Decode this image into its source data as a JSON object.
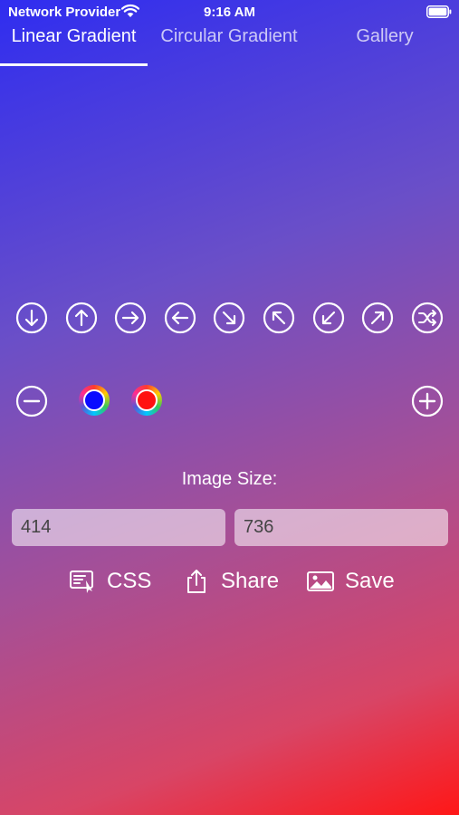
{
  "status_bar": {
    "carrier": "Network Provider",
    "time": "9:16 AM"
  },
  "tabs": [
    {
      "label": "Linear Gradient",
      "selected": true
    },
    {
      "label": "Circular Gradient",
      "selected": false
    },
    {
      "label": "Gallery",
      "selected": false
    }
  ],
  "direction_buttons": [
    "arrow-down-icon",
    "arrow-up-icon",
    "arrow-right-icon",
    "arrow-left-icon",
    "arrow-down-right-icon",
    "arrow-up-left-icon",
    "arrow-down-left-icon",
    "arrow-up-right-icon",
    "shuffle-icon"
  ],
  "colors": [
    {
      "name": "color-1",
      "value": "#0a0aff"
    },
    {
      "name": "color-2",
      "value": "#ff1111"
    }
  ],
  "image_size": {
    "label": "Image Size:",
    "width": "414",
    "height": "736"
  },
  "actions": {
    "css_label": "CSS",
    "share_label": "Share",
    "save_label": "Save"
  },
  "theme": {
    "gradient_start": "#2f2df0",
    "gradient_end": "#ff1717"
  }
}
